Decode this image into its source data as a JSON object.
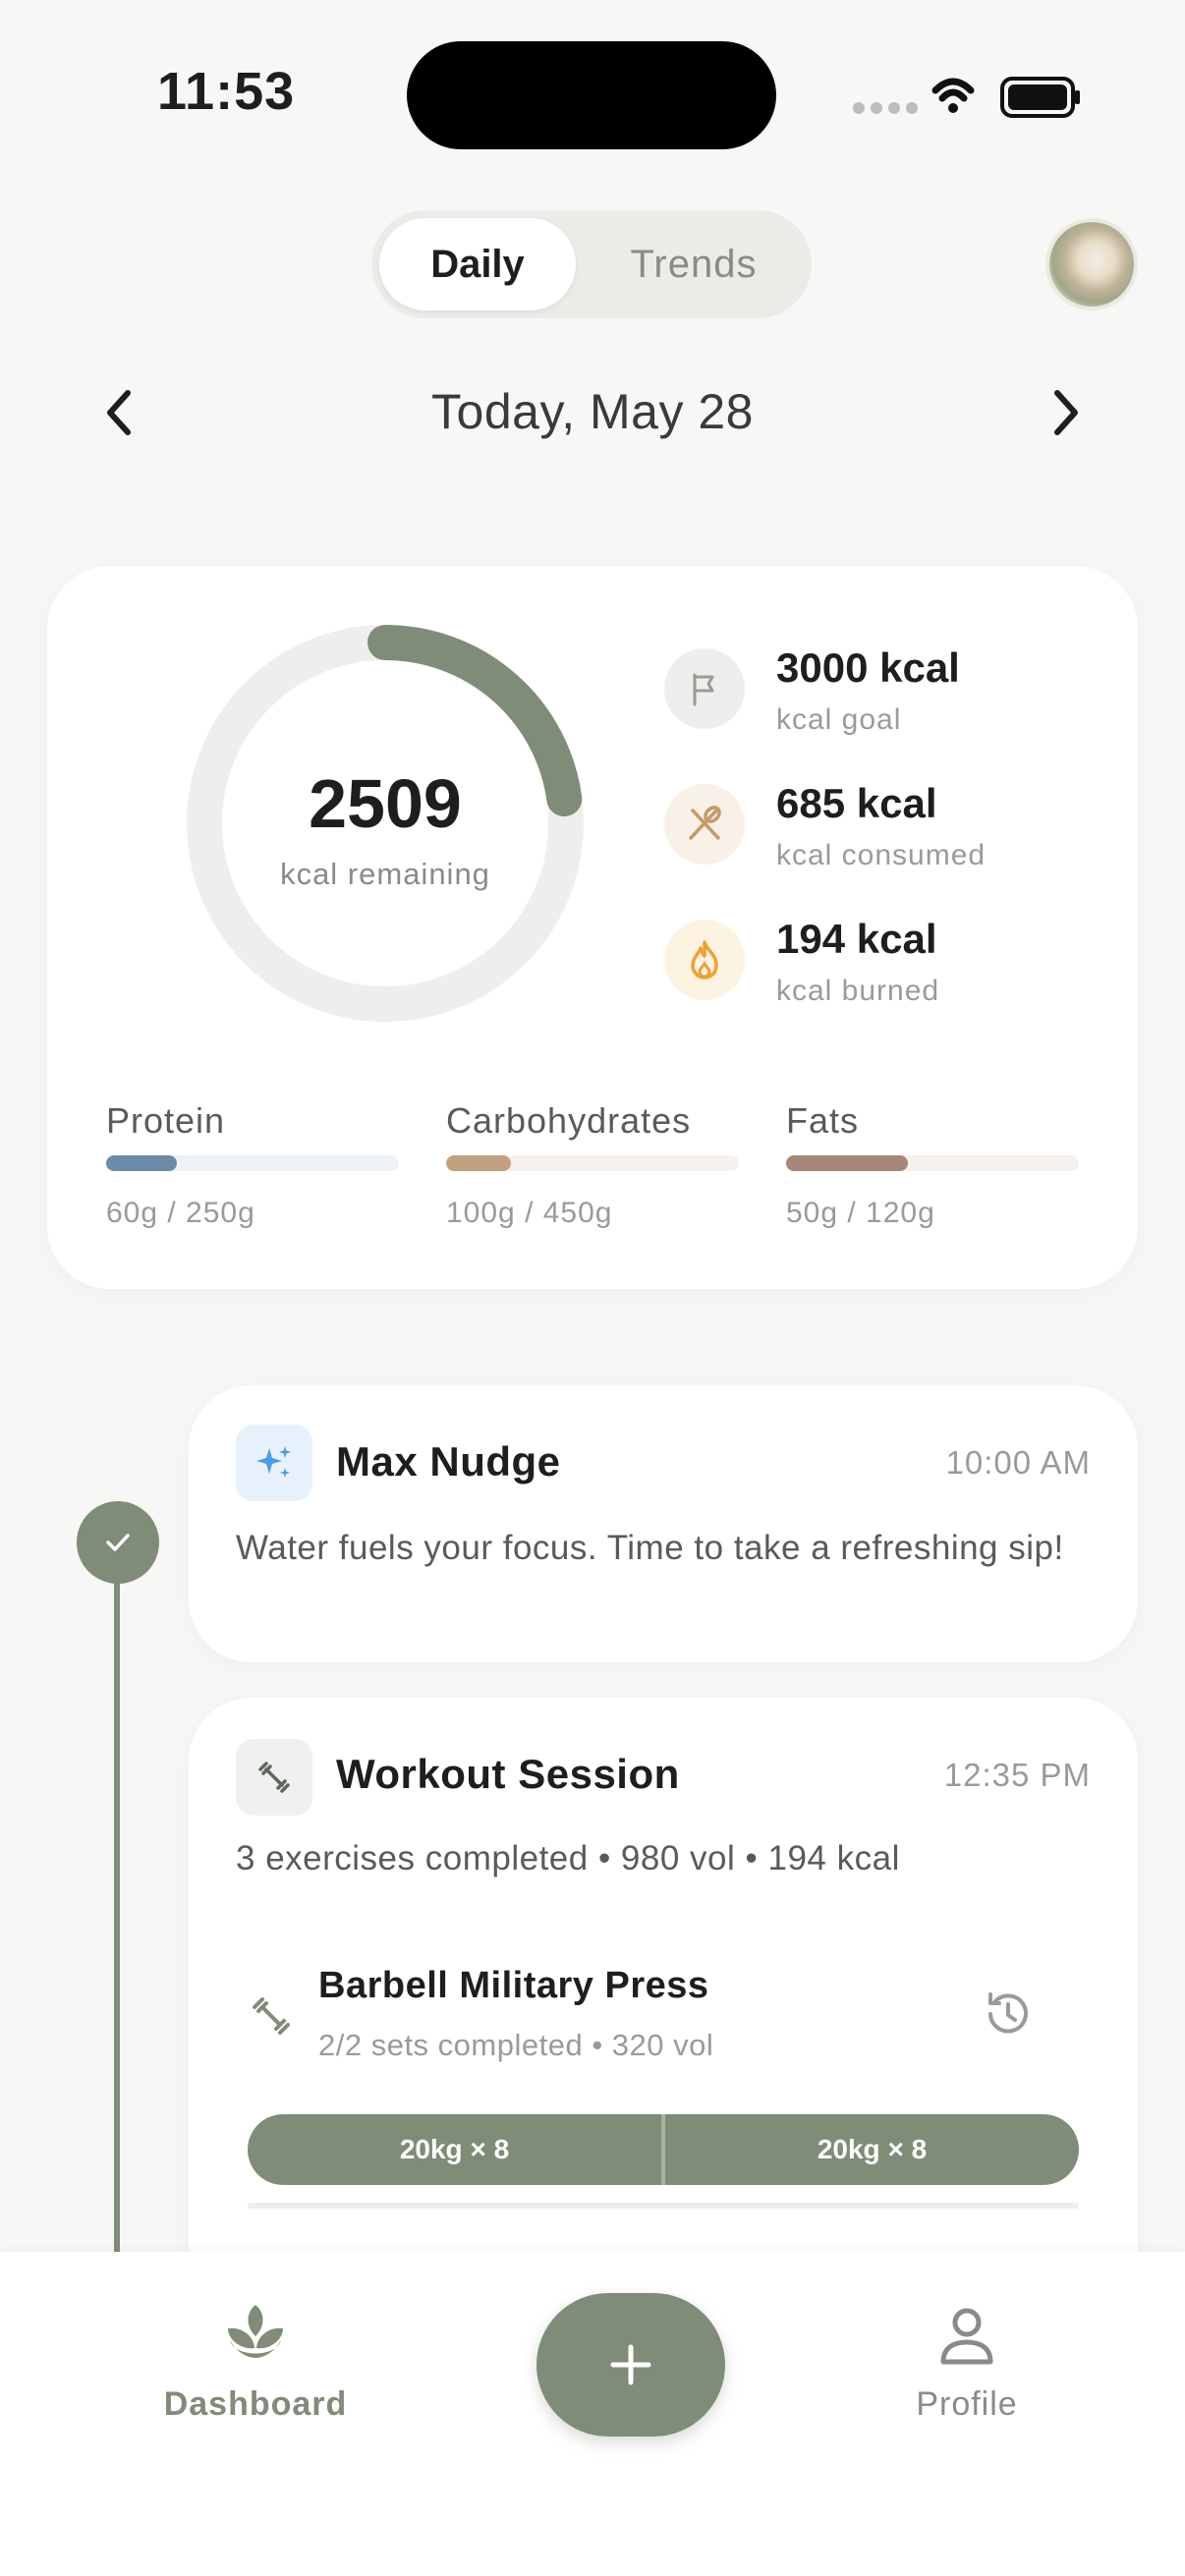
{
  "status_bar": {
    "time": "11:53"
  },
  "segment": {
    "daily": "Daily",
    "trends": "Trends",
    "selected": "Daily"
  },
  "date_nav": {
    "title": "Today, May 28"
  },
  "summary": {
    "remaining_value": "2509",
    "remaining_label": "kcal remaining",
    "progress_fraction": 0.2283,
    "ring_color": "#7F8C77",
    "stats": [
      {
        "icon": "flag-icon",
        "value": "3000 kcal",
        "label": "kcal goal",
        "color": "#9A9A96"
      },
      {
        "icon": "utensils-icon",
        "value": "685 kcal",
        "label": "kcal consumed",
        "color": "#C49B68"
      },
      {
        "icon": "flame-icon",
        "value": "194 kcal",
        "label": "kcal burned",
        "color": "#F0A030"
      }
    ],
    "macros": [
      {
        "name": "Protein",
        "value": "60g / 250g",
        "fraction": 0.24,
        "color": "#6C8BAA",
        "track": "#EEF2F6"
      },
      {
        "name": "Carbohydrates",
        "value": "100g / 450g",
        "fraction": 0.222,
        "color": "#C4A17E",
        "track": "#F5F1EC"
      },
      {
        "name": "Fats",
        "value": "50g / 120g",
        "fraction": 0.417,
        "color": "#A68878",
        "track": "#F3F0EE"
      }
    ]
  },
  "timeline": {
    "nudge": {
      "title": "Max Nudge",
      "time": "10:00 AM",
      "text": "Water fuels your focus. Time to take a refreshing sip!"
    },
    "workout": {
      "title": "Workout Session",
      "time": "12:35 PM",
      "summary": "3 exercises completed • 980 vol • 194 kcal",
      "exercise": {
        "title": "Barbell Military Press",
        "sub": "2/2 sets completed • 320 vol",
        "sets": [
          "20kg × 8",
          "20kg × 8"
        ]
      }
    }
  },
  "bottom_nav": {
    "dashboard": "Dashboard",
    "profile": "Profile"
  },
  "colors": {
    "accent": "#7F8C77",
    "background": "#F7F7F5"
  }
}
